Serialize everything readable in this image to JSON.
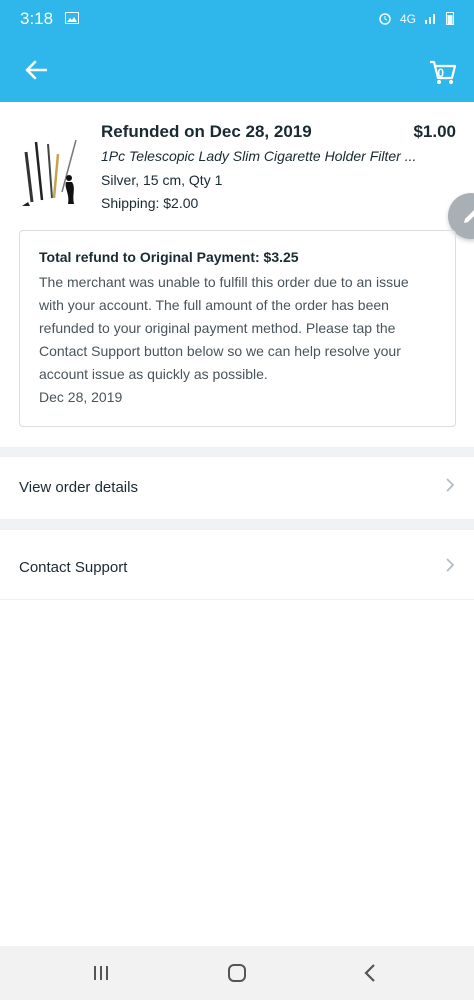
{
  "status_bar": {
    "time": "3:18",
    "network": "4G"
  },
  "header": {
    "cart_count": "0"
  },
  "order": {
    "status": "Refunded on Dec 28, 2019",
    "price": "$1.00",
    "product_name": "1Pc Telescopic Lady Slim Cigarette Holder Filter ...",
    "variant": "Silver, 15 cm, Qty 1",
    "shipping": "Shipping: $2.00"
  },
  "refund": {
    "title": "Total refund to Original Payment: $3.25",
    "message": "The merchant was unable to fulfill this order due to an issue with your account. The full amount of the order has been refunded to your original payment method. Please tap the Contact Support button below so we can help resolve your account issue as quickly as possible.",
    "date": "Dec 28, 2019"
  },
  "actions": {
    "view_order_details": "View order details",
    "contact_support": "Contact Support"
  },
  "colors": {
    "brand": "#2fb7ec",
    "text": "#192a32",
    "muted": "#48545b"
  }
}
